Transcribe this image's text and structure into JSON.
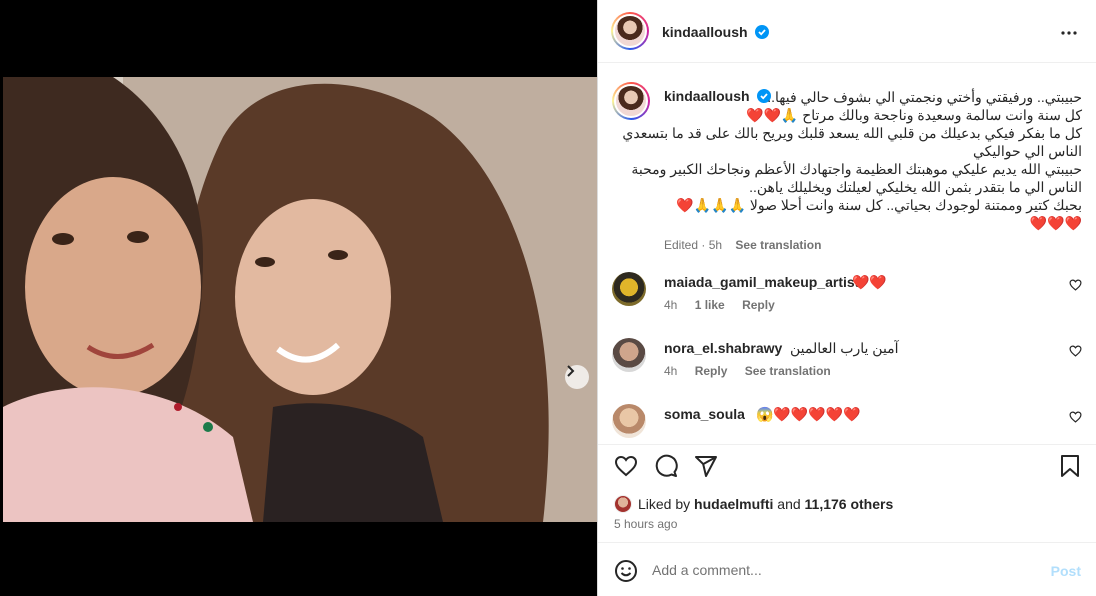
{
  "post": {
    "author": "kindaalloush",
    "verified": true,
    "caption": "حبيبتي.. ورفيقتي وأختي ونجمتي الي بشوف حالي فيها..\nكل سنة وانت سالمة وسعيدة وناجحة وبالك مرتاح 🙏❤️❤️\nكل ما بفكر فيكي بدعيلك من قلبي الله يسعد قلبك ويريح بالك على قد ما بتسعدي الناس الي حواليكي\nحبيبتي الله يديم عليكي موهبتك العظيمة واجتهادك الأعظم ونجاحك الكبير ومحبة الناس الي ما بتقدر بثمن الله يخليكي لعيلتك ويخليلك ياهن..\nبحبك كتير وممتنة لوجودك بحياتي.. كل سنة وانت أحلا صولا 🙏🙏🙏❤️\n❤️❤️❤️",
    "caption_edited": "Edited · 5h",
    "see_translation": "See translation",
    "likes": {
      "prefix": "Liked by",
      "user": "hudaelmufti",
      "conjunction": "and",
      "others": "11,176 others"
    },
    "time_ago": "5 hours ago"
  },
  "comments": [
    {
      "user": "maiada_gamil_makeup_artist",
      "text": "❤️❤️",
      "time": "4h",
      "likes": "1 like",
      "reply": "Reply",
      "translate": ""
    },
    {
      "user": "nora_el.shabrawy",
      "text": "آمين يارب العالمين",
      "time": "4h",
      "likes": "",
      "reply": "Reply",
      "translate": "See translation"
    },
    {
      "user": "soma_soula",
      "text": "😱❤️❤️❤️❤️❤️",
      "time": "",
      "likes": "",
      "reply": "",
      "translate": ""
    }
  ],
  "composer": {
    "placeholder": "Add a comment...",
    "post_label": "Post"
  },
  "carousel": {
    "count": 5,
    "active_index": 0
  },
  "icons": {
    "more": "more-options-icon",
    "like": "heart-icon",
    "comment": "comment-icon",
    "share": "share-icon",
    "save": "bookmark-icon",
    "emoji": "emoji-icon",
    "next": "chevron-right-icon"
  },
  "colors": {
    "verified": "#0095f6",
    "heart": "#ed1c24",
    "muted": "#737373",
    "post_disabled": "#b2dffc"
  }
}
